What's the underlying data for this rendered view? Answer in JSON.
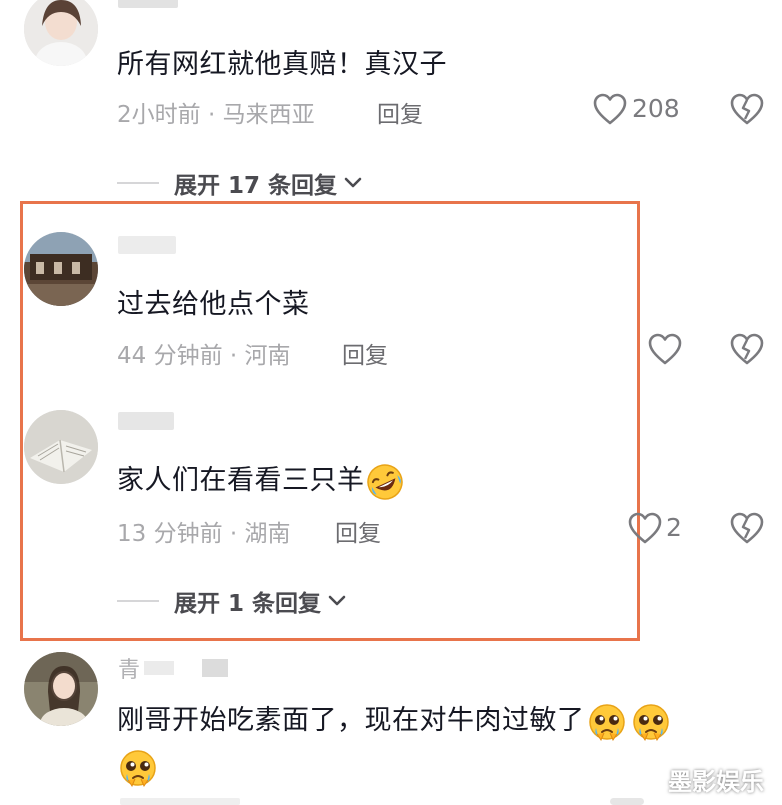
{
  "colors": {
    "highlight_border": "#e8744b",
    "text_primary": "#161823",
    "text_meta": "#a8a8ab",
    "icon": "#7a7a7e"
  },
  "icons": {
    "like": "heart-outline-icon",
    "dislike": "broken-heart-icon",
    "expand": "chevron-down-icon",
    "emoji_laugh": "rolling-laughing-emoji",
    "emoji_plead": "pleading-face-emoji"
  },
  "comments": [
    {
      "text": "所有网红就他真赔！真汉子",
      "time": "2小时前",
      "location": "马来西亚",
      "reply_label": "回复",
      "likes": "208",
      "expand_label": "展开 17 条回复"
    },
    {
      "text": "过去给他点个菜",
      "time": "44 分钟前",
      "location": "河南",
      "reply_label": "回复",
      "likes": ""
    },
    {
      "text": "家人们在看看三只羊",
      "time": "13 分钟前",
      "location": "湖南",
      "reply_label": "回复",
      "likes": "2",
      "expand_label": "展开 1 条回复"
    },
    {
      "username_partial": "青",
      "text": "刚哥开始吃素面了，现在对牛肉过敏了"
    }
  ],
  "meta_separator": "·",
  "watermark": "墨影娱乐"
}
